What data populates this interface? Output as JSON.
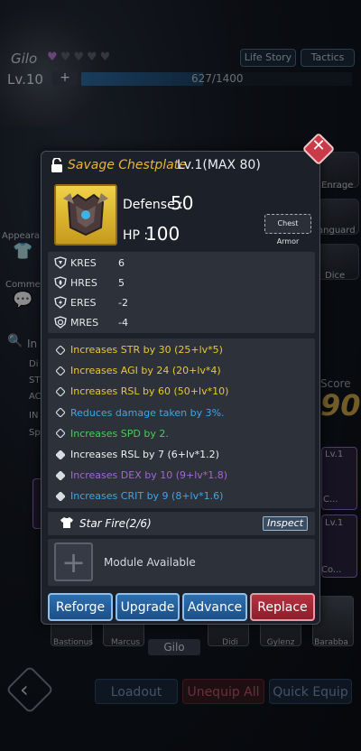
{
  "hero": {
    "name": "Gilo",
    "hearts_filled": 1,
    "hearts_total": 5,
    "level": "Lv.10",
    "xp_plus": "+",
    "xp_text": "627/1400",
    "xp_progress": 0.448
  },
  "top_buttons": {
    "life_story": "Life Story",
    "tactics": "Tactics"
  },
  "side": {
    "appearance": "Appearan",
    "comment": "Commen",
    "info": "In",
    "rows": [
      "Di",
      "ST",
      "AC",
      "IN",
      "Sp"
    ]
  },
  "right_cards": {
    "enrage": "Enrage",
    "vanguard": "anguard",
    "dice": "Dice"
  },
  "score": {
    "label": "Score",
    "value": "90"
  },
  "roster": {
    "names": [
      "Bastionus",
      "Marcus",
      "Gilo",
      "Didi",
      "Gylenz",
      "Barabba"
    ],
    "level_tags": [
      "Lv.1",
      "Lv.1"
    ],
    "c_tags": [
      "C...",
      "Co..."
    ]
  },
  "bottom_buttons": {
    "loadout": "Loadout",
    "unequip": "Unequip All",
    "quick_equip": "Quick Equip"
  },
  "item": {
    "title": "Savage Chestplate",
    "level": "Lv.1(MAX 80)",
    "defense_label": "Defense :",
    "defense_value": "50",
    "hp_label": "HP :",
    "hp_value": "100",
    "type": "Chest Armor"
  },
  "resistances": [
    {
      "name": "KRES",
      "value": "6",
      "icon": "kinetic-shield-icon"
    },
    {
      "name": "HRES",
      "value": "5",
      "icon": "heat-shield-icon"
    },
    {
      "name": "ERES",
      "value": "-2",
      "icon": "energy-shield-icon"
    },
    {
      "name": "MRES",
      "value": "-4",
      "icon": "magic-shield-icon"
    }
  ],
  "bonuses": [
    {
      "text": "Increases STR by 30 (25+lv*5)",
      "color": "#e8c83a"
    },
    {
      "text": "Increases AGI by 24 (20+lv*4)",
      "color": "#e8c83a"
    },
    {
      "text": "Increases RSL by 60 (50+lv*10)",
      "color": "#e8c83a"
    },
    {
      "text": "Reduces damage taken by 3%.",
      "color": "#3fa6e8"
    },
    {
      "text": "Increases SPD by 2.",
      "color": "#4ccc5a"
    },
    {
      "text": "Increases RSL by 7 (6+lv*1.2)",
      "color": "#eef0f3"
    },
    {
      "text": "Increases DEX by 10 (9+lv*1.8)",
      "color": "#a465d8"
    },
    {
      "text": "Increases CRIT by 9 (8+lv*1.6)",
      "color": "#3fa6e8"
    }
  ],
  "set": {
    "name": "Star Fire(2/6)",
    "inspect": "Inspect"
  },
  "module": {
    "text": "Module Available",
    "plus": "+"
  },
  "actions": {
    "reforge": "Reforge",
    "upgrade": "Upgrade",
    "advance": "Advance",
    "replace": "Replace"
  },
  "colors": {
    "title_gold": "#e9b43c",
    "accent_blue": "#2d6fb0",
    "accent_red": "#b73140"
  }
}
